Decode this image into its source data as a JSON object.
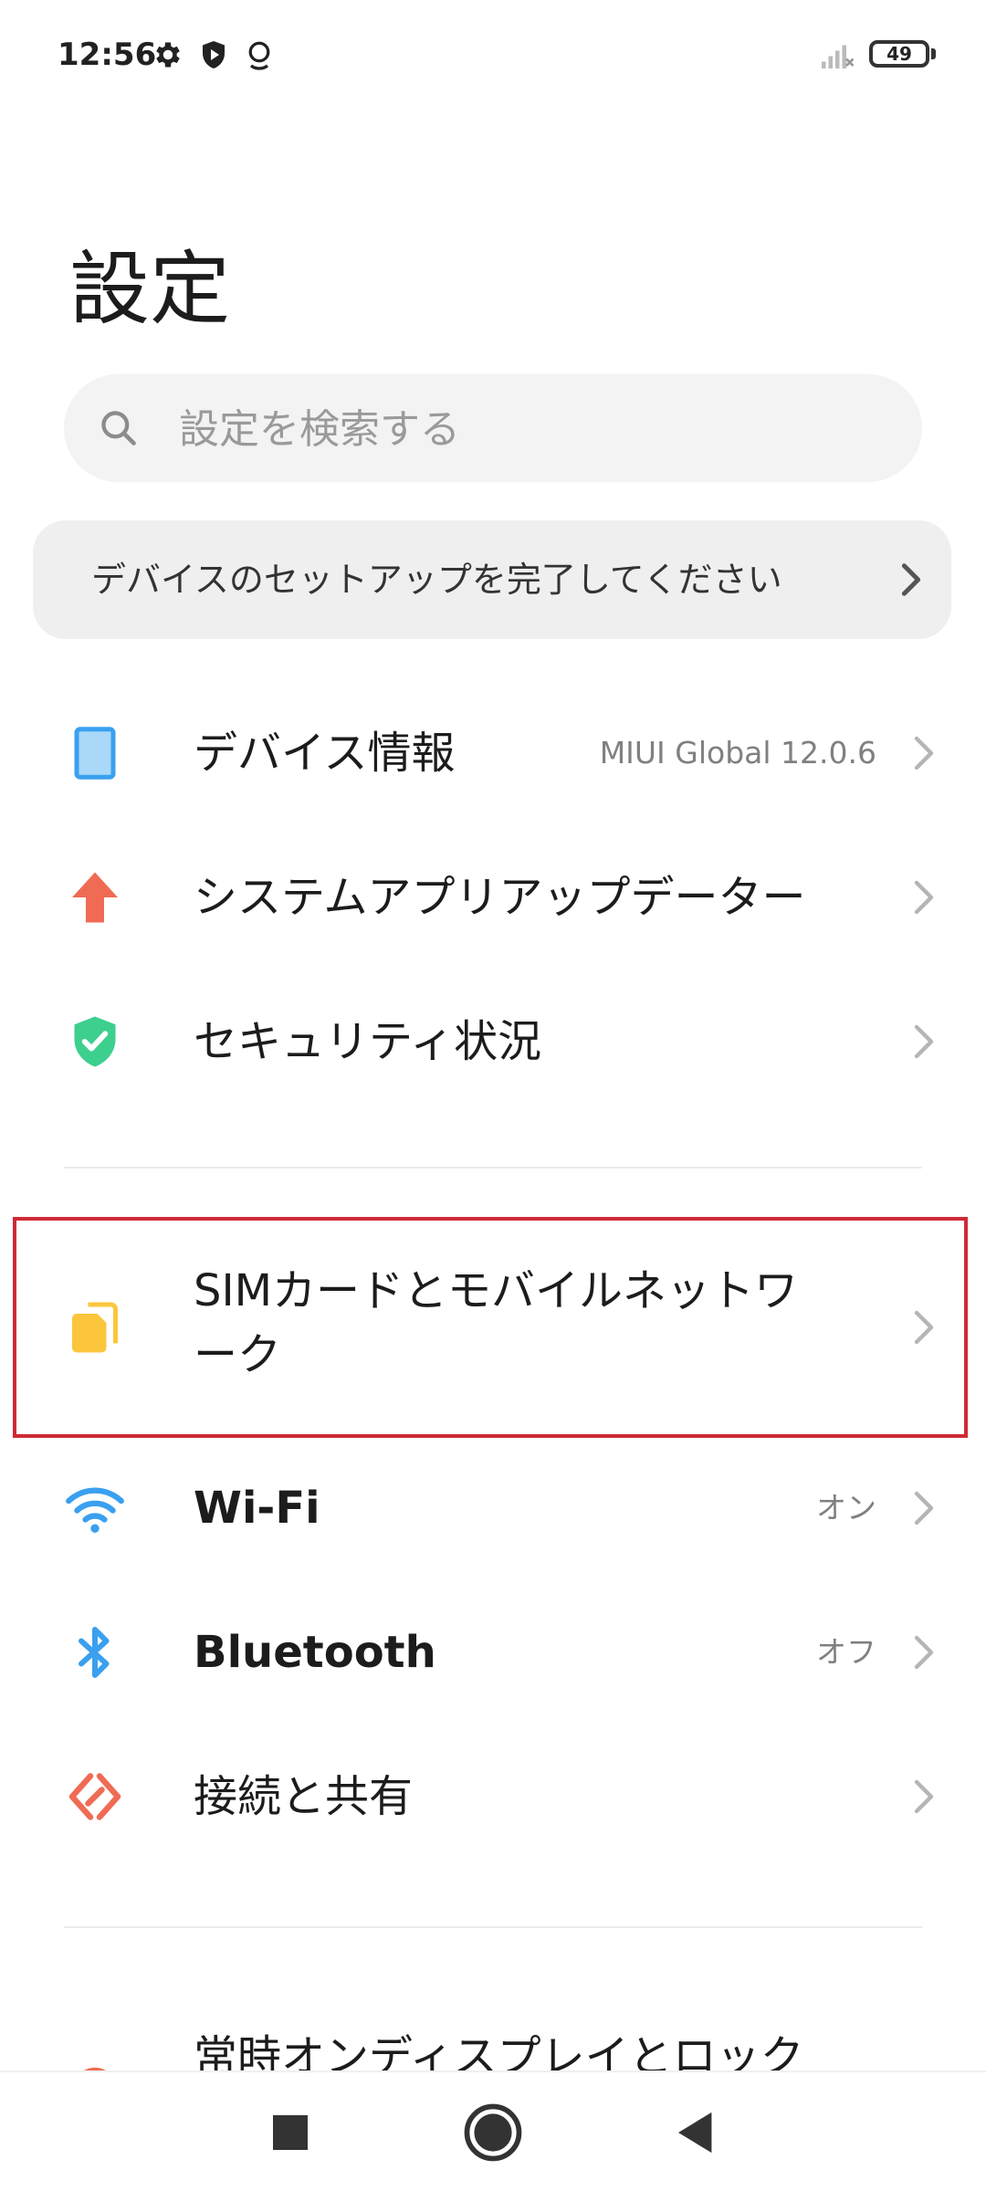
{
  "status_bar": {
    "time": "12:56",
    "battery": "49",
    "icons": [
      "gear-icon",
      "shield-icon",
      "location-icon",
      "signal-icon"
    ]
  },
  "header": {
    "title": "設定"
  },
  "search": {
    "placeholder": "設定を検索する",
    "value": ""
  },
  "setup_banner": {
    "label": "デバイスのセットアップを完了してください"
  },
  "rows": {
    "device_info": {
      "label": "デバイス情報",
      "value": "MIUI Global 12.0.6",
      "icon": "tablet-icon"
    },
    "system_updater": {
      "label": "システムアプリアップデーター",
      "icon": "up-arrow-icon"
    },
    "security": {
      "label": "セキュリティ状況",
      "icon": "shield-check-icon"
    },
    "sim": {
      "label_line1": "SIMカードとモバイルネットワ",
      "label_line2": "ーク",
      "icon": "sim-card-icon"
    },
    "wifi": {
      "label": "Wi-Fi",
      "value": "オン",
      "icon": "wifi-icon"
    },
    "bluetooth": {
      "label": "Bluetooth",
      "value": "オフ",
      "icon": "bluetooth-icon"
    },
    "connection": {
      "label": "接続と共有",
      "icon": "share-icon"
    },
    "aod": {
      "label": "常時オンディスプレイとロック",
      "icon": "lock-icon"
    }
  },
  "colors": {
    "accent_blue": "#3aa0ef",
    "updater_red": "#f06b54",
    "security_green": "#3ccf8e",
    "sim_yellow": "#fcc63c",
    "highlight_red": "#cf2a36"
  },
  "nav": {
    "buttons": [
      "recents-square-icon",
      "home-circle-icon",
      "back-triangle-icon"
    ]
  }
}
